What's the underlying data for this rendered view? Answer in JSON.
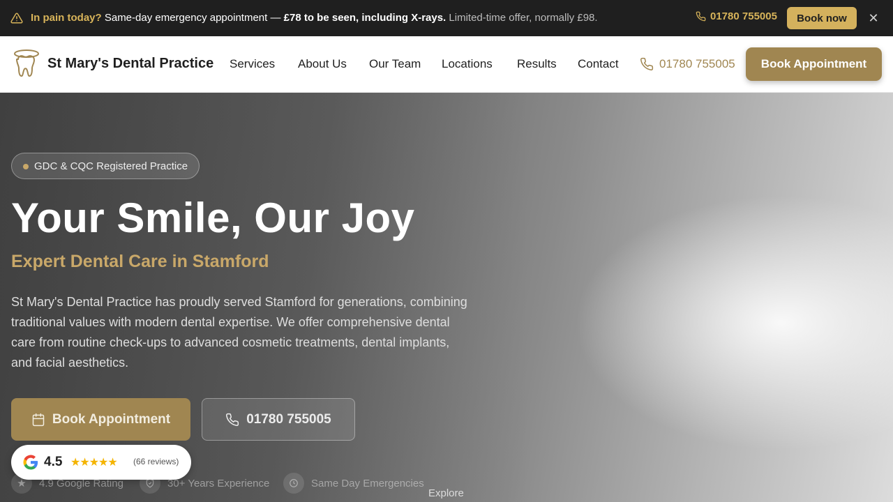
{
  "announcement": {
    "highlight": "In pain today?",
    "message": "Same-day emergency appointment —",
    "price": "£78 to be seen, including X-rays.",
    "note": "Limited-time offer, normally £98.",
    "phone": "01780 755005",
    "book_label": "Book now",
    "close_icon": "close-icon",
    "warning_icon": "warning-icon"
  },
  "header": {
    "brand": "St Mary's Dental Practice",
    "logo_icon": "tooth-icon",
    "nav": [
      "Services",
      "About Us",
      "Our Team",
      "Locations",
      "Results",
      "Contact"
    ],
    "phone": "01780 755005",
    "book_label": "Book Appointment"
  },
  "hero": {
    "badge": "GDC & CQC Registered Practice",
    "title": "Your Smile, Our Joy",
    "tagline": "Expert Dental Care in Stamford",
    "intro": "St Mary's Dental Practice has proudly served Stamford for generations, combining traditional values with modern dental expertise. We offer comprehensive dental care from routine check-ups to advanced cosmetic treatments, dental implants, and facial aesthetics.",
    "cta_book": "Book Appointment",
    "cta_call": "01780 755005",
    "trust": [
      {
        "icon": "star-icon",
        "label": "4.9 Google Rating"
      },
      {
        "icon": "shield-check-icon",
        "label": "30+ Years Experience"
      },
      {
        "icon": "clock-icon",
        "label": "Same Day Emergencies"
      }
    ],
    "explore": "Explore"
  },
  "review_widget": {
    "score": "4.5",
    "stars": "★★★★★",
    "count": "(66 reviews)",
    "icon": "google-icon"
  },
  "colors": {
    "accent_gold": "#a08651",
    "bar_gold": "#d4b15d",
    "dark_bar": "#1f1f1f"
  }
}
